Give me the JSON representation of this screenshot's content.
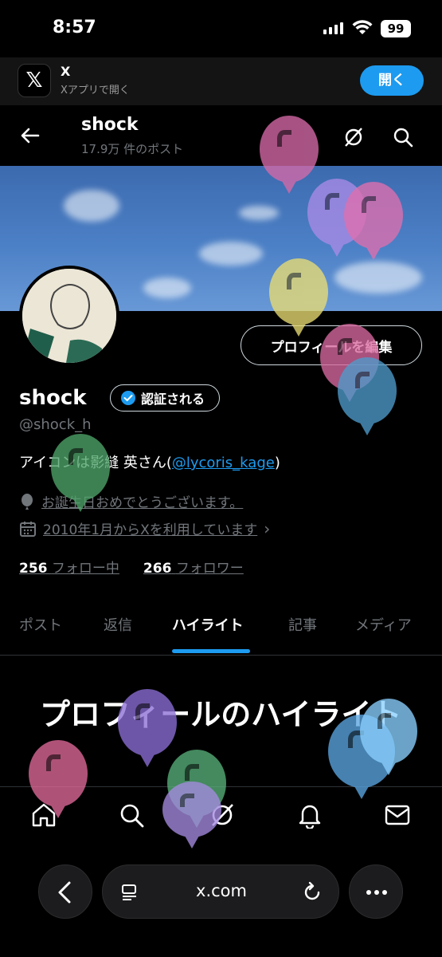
{
  "status_bar": {
    "time": "8:57",
    "battery": "99"
  },
  "app_banner": {
    "app_name": "X",
    "subtitle": "Xアプリで開く",
    "open_label": "開く"
  },
  "header": {
    "title": "shock",
    "post_count": "17.9万 件のポスト"
  },
  "profile": {
    "edit_label": "プロフィールを編集",
    "display_name": "shock",
    "verified_label": "認証される",
    "handle": "@shock_h",
    "bio_prefix": "アイコンは影縫 英さん(",
    "bio_mention": "@lycoris_kage",
    "bio_suffix": ")",
    "birthday": "お誕生日おめでとうございます。",
    "joined": "2010年1月からXを利用しています",
    "following_count": "256",
    "following_label": "フォロー中",
    "followers_count": "266",
    "followers_label": "フォロワー"
  },
  "tabs": [
    {
      "label": "ポスト"
    },
    {
      "label": "返信"
    },
    {
      "label": "ハイライト",
      "active": true
    },
    {
      "label": "記事"
    },
    {
      "label": "メディア"
    }
  ],
  "highlights": {
    "title": "プロフィールのハイライト"
  },
  "bottom_nav": [
    "home-icon",
    "search-icon",
    "grok-icon",
    "notifications-icon",
    "messages-icon"
  ],
  "browser": {
    "url": "x.com"
  },
  "colors": {
    "accent": "#1d9bf0",
    "background": "#000000",
    "secondary_text": "#71767b"
  }
}
